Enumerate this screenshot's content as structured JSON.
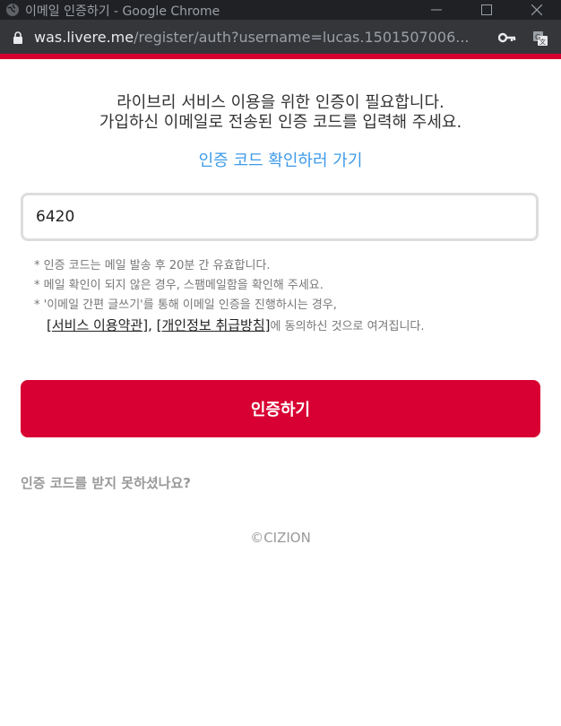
{
  "window": {
    "title": "이메일 인증하기 - Google Chrome",
    "url_host": "was.livere.me",
    "url_path": "/register/auth?username=lucas.1501507006..."
  },
  "colors": {
    "accent": "#d80032",
    "link": "#3d9be9"
  },
  "main": {
    "headline_line1": "라이브리 서비스 이용을 위한 인증이 필요합니다.",
    "headline_line2": "가입하신 이메일로 전송된 인증 코드를 입력해 주세요.",
    "verify_link": "인증 코드 확인하러 가기",
    "code_value": "6420",
    "notes": [
      "* 인증 코드는 메일 발송 후 20분 간 유효합니다.",
      "* 메일 확인이 되지 않은 경우, 스팸메일함을 확인해 주세요.",
      "* '이메일 간편 글쓰기'를 통해 이메일 인증을 진행하시는 경우,"
    ],
    "terms_link": "서비스 이용약관",
    "privacy_link": "개인정보 취급방침",
    "consent_suffix": "에 동의하신 것으로 여겨집니다.",
    "submit_label": "인증하기",
    "resend_label": "인증 코드를 받지 못하셨나요?",
    "copyright": "©CIZION"
  }
}
